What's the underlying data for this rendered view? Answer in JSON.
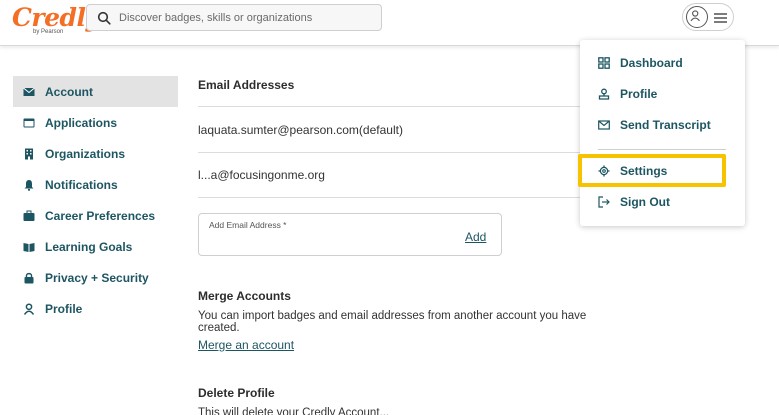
{
  "brand": {
    "logo_text": "Credly",
    "logo_sub": "by Pearson",
    "color": "#f46f25"
  },
  "search": {
    "placeholder": "Discover badges, skills or organizations",
    "icon": "search-icon"
  },
  "user_menu": {
    "avatar_icon": "user-icon",
    "menu_icon": "hamburger-icon"
  },
  "sidebar": {
    "accent": "#1d5662",
    "items": [
      {
        "label": "Account",
        "icon": "envelope-icon",
        "active": true
      },
      {
        "label": "Applications",
        "icon": "window-icon"
      },
      {
        "label": "Organizations",
        "icon": "building-icon"
      },
      {
        "label": "Notifications",
        "icon": "bell-icon"
      },
      {
        "label": "Career Preferences",
        "icon": "briefcase-icon"
      },
      {
        "label": "Learning Goals",
        "icon": "book-icon"
      },
      {
        "label": "Privacy + Security",
        "icon": "lock-icon"
      },
      {
        "label": "Profile",
        "icon": "person-icon"
      }
    ]
  },
  "main": {
    "email_heading": "Email Addresses",
    "emails": [
      "laquata.sumter@pearson.com(default)",
      "l...a@focusingonme.org"
    ],
    "add_email_label": "Add Email Address *",
    "add_link": "Add",
    "merge_heading": "Merge Accounts",
    "merge_text": "You can import badges and email addresses from another account you have created.",
    "merge_link": "Merge an account",
    "delete_heading": "Delete Profile",
    "delete_text": "This will delete your Credly Account..."
  },
  "dropdown": {
    "items": [
      {
        "label": "Dashboard",
        "icon": "grid-icon"
      },
      {
        "label": "Profile",
        "icon": "profile-badge-icon"
      },
      {
        "label": "Send Transcript",
        "icon": "envelope-icon"
      },
      {
        "label": "Settings",
        "icon": "gear-icon",
        "highlighted": true
      },
      {
        "label": "Sign Out",
        "icon": "sign-out-icon"
      }
    ],
    "highlight_color": "#f7c300"
  }
}
